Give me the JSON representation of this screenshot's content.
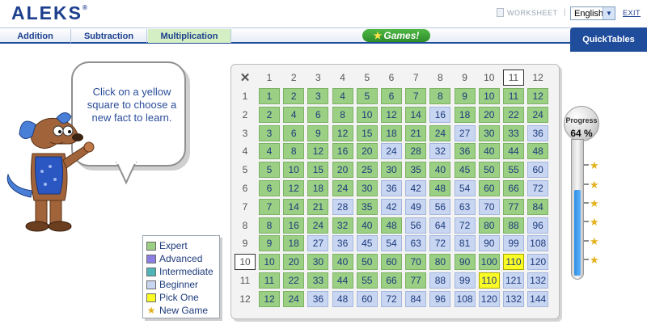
{
  "app": {
    "logo": "ALEKS",
    "trademark": "®"
  },
  "header": {
    "worksheet_label": "WORKSHEET",
    "language": "English",
    "exit_label": "EXIT"
  },
  "tabs": [
    {
      "label": "Addition",
      "active": false
    },
    {
      "label": "Subtraction",
      "active": false
    },
    {
      "label": "Multiplication",
      "active": true
    }
  ],
  "games_label": "Games!",
  "quicktables_label": "QuickTables",
  "instruction": "Click on a yellow square to choose a new fact to learn.",
  "legend": [
    {
      "label": "Expert",
      "color": "#9bcf84"
    },
    {
      "label": "Advanced",
      "color": "#8b7fe3"
    },
    {
      "label": "Intermediate",
      "color": "#4fb5b8"
    },
    {
      "label": "Beginner",
      "color": "#c9d6f2"
    },
    {
      "label": "Pick One",
      "color": "#fbfb26"
    },
    {
      "label": "New Game",
      "icon": "star-icon"
    }
  ],
  "progress": {
    "title": "Progress",
    "value_text": "64 %",
    "fraction": 0.64
  },
  "table": {
    "corner_symbol": "✕",
    "selected_column": 11,
    "selected_row": 10,
    "levels": {
      "E": "expert",
      "B": "beginner",
      "Y": "pick"
    },
    "grid": [
      "EEEEEEEEEEEE",
      "EEEEEEEBEEEE",
      "EEEEEEEEBEEB",
      "EEEEEBEBEEEE",
      "EEEEEEEEEEEB",
      "EEEEEBBEBEEB",
      "EEEBEBBBBBEE",
      "EEEEEEBBBEEB",
      "EEBBBBBBBBBB",
      "EEEEEEEEEEYB",
      "EEEEEEEBBYBB",
      "EEBBBBBBBBBB"
    ]
  }
}
